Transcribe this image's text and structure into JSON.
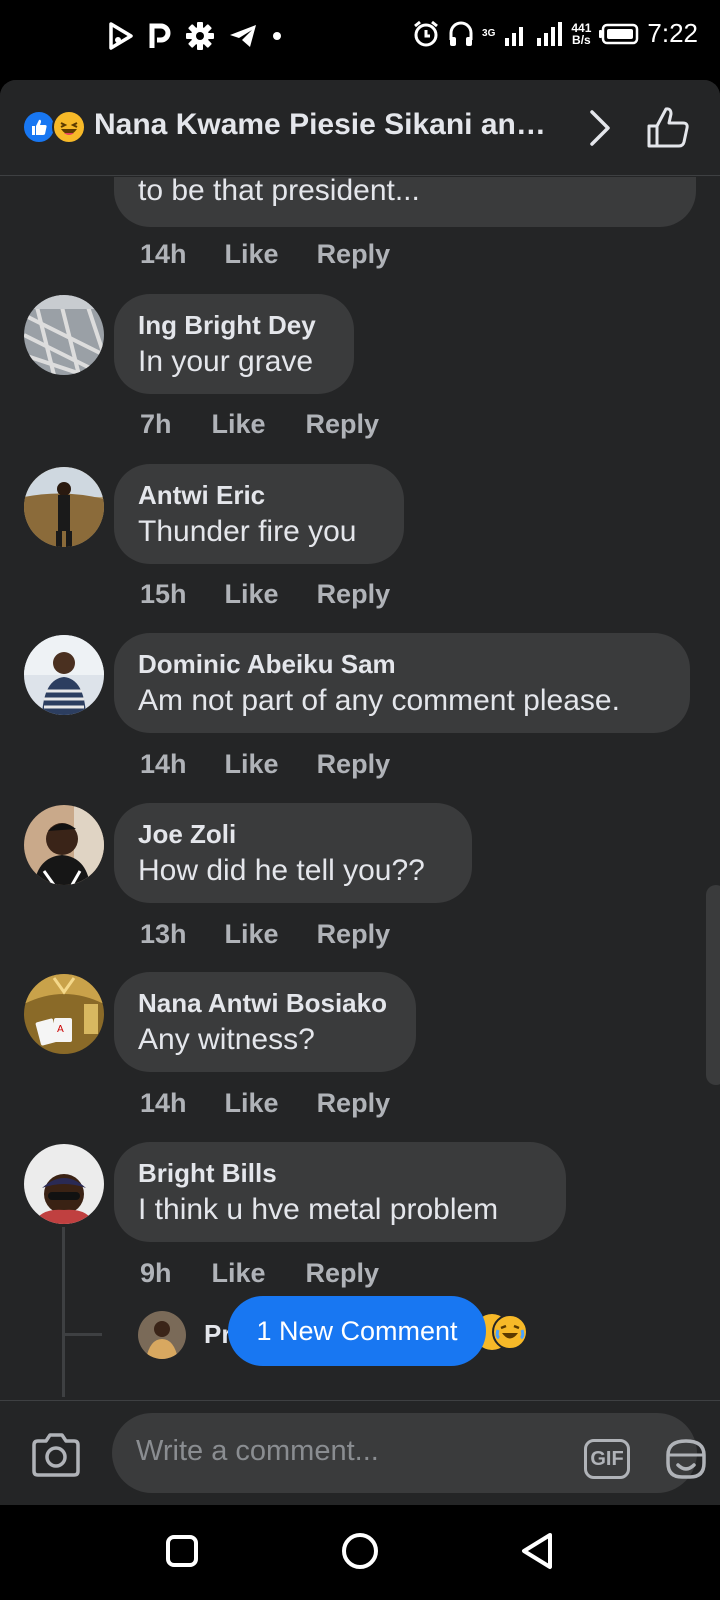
{
  "status_bar": {
    "time": "7:22",
    "network_type": "3G",
    "data_rate": "441",
    "data_rate_unit": "B/s"
  },
  "header": {
    "title": "Nana Kwame Piesie Sikani and ..."
  },
  "comments": [
    {
      "name": "",
      "text": "to be that president...",
      "time": "14h",
      "like": "Like",
      "reply": "Reply"
    },
    {
      "name": "Ing Bright Dey",
      "text": "In your grave",
      "time": "7h",
      "like": "Like",
      "reply": "Reply"
    },
    {
      "name": "Antwi Eric",
      "text": "Thunder fire you",
      "time": "15h",
      "like": "Like",
      "reply": "Reply"
    },
    {
      "name": "Dominic Abeiku Sam",
      "text": "Am not part of any comment please.",
      "time": "14h",
      "like": "Like",
      "reply": "Reply"
    },
    {
      "name": "Joe Zoli",
      "text": "How did he tell you??",
      "time": "13h",
      "like": "Like",
      "reply": "Reply"
    },
    {
      "name": "Nana Antwi Bosiako",
      "text": "Any witness?",
      "time": "14h",
      "like": "Like",
      "reply": "Reply"
    },
    {
      "name": "Bright Bills",
      "text": "I think u hve metal problem",
      "time": "9h",
      "like": "Like",
      "reply": "Reply"
    }
  ],
  "reply_preview": {
    "name_fragment": "Pr"
  },
  "new_comment_pill": "1 New Comment",
  "composer": {
    "placeholder": "Write a comment...",
    "gif_label": "GIF"
  },
  "colors": {
    "background": "#242526",
    "bubble": "#3a3b3c",
    "accent": "#1877f2",
    "meta_text": "#b0b3b8"
  },
  "icons": [
    "play-store-icon",
    "p-app-icon",
    "gear-icon",
    "telegram-icon",
    "alarm-icon",
    "headphones-icon",
    "signal-icon",
    "battery-icon",
    "like-reaction-icon",
    "haha-reaction-icon",
    "chevron-right-icon",
    "thumbs-up-icon",
    "camera-icon",
    "gif-icon",
    "sticker-icon",
    "emoji-icon",
    "nav-recents-icon",
    "nav-home-icon",
    "nav-back-icon"
  ]
}
